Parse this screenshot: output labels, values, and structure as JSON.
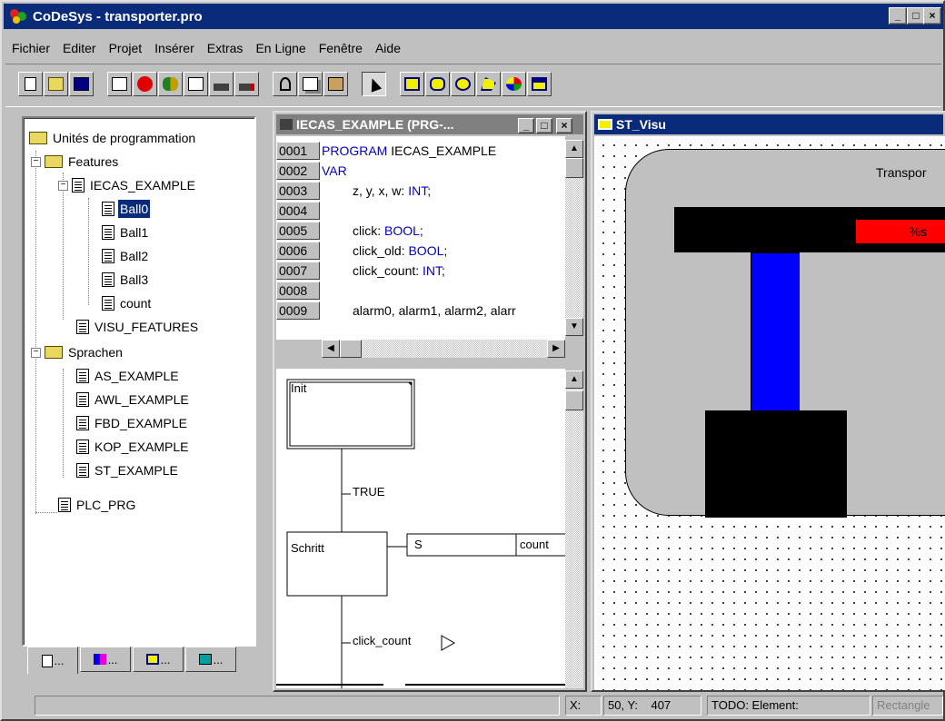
{
  "window": {
    "title": "CoDeSys - transporter.pro",
    "minimize_glyph": "_",
    "restore_glyph": "□",
    "close_glyph": "×",
    "title_color": "#0a2a7a"
  },
  "menu": {
    "items": [
      "Fichier",
      "Editer",
      "Projet",
      "Insérer",
      "Extras",
      "En Ligne",
      "Fenêtre",
      "Aide"
    ]
  },
  "toolbar": {
    "icons": [
      "new-icon",
      "open-icon",
      "save-icon",
      "compile-icon",
      "stop-icon",
      "run-icon",
      "step-over-icon",
      "breakpoint-icon",
      "login-icon",
      "cut-icon",
      "copy-icon",
      "paste-icon",
      "pointer-icon",
      "rectangle-icon",
      "rounded-rectangle-icon",
      "ellipse-icon",
      "polygon-icon",
      "bitmap-icon",
      "visualization-icon"
    ]
  },
  "tree": {
    "root": "Unités de programmation",
    "nodes": {
      "features": "Features",
      "iecas": "IECAS_EXAMPLE",
      "ball0": "Ball0",
      "ball1": "Ball1",
      "ball2": "Ball2",
      "ball3": "Ball3",
      "count": "count",
      "visu_features": "VISU_FEATURES",
      "sprachen": "Sprachen",
      "as_example": "AS_EXAMPLE",
      "awl_example": "AWL_EXAMPLE",
      "fbd_example": "FBD_EXAMPLE",
      "kop_example": "KOP_EXAMPLE",
      "st_example": "ST_EXAMPLE",
      "plc_prg": "PLC_PRG"
    },
    "tabs": [
      "...",
      "...",
      "...",
      "..."
    ]
  },
  "editor": {
    "title": "IECAS_EXAMPLE (PRG-...",
    "title_color": "#808080",
    "lines": [
      {
        "num": "0001",
        "kw": "PROGRAM",
        "rest": " IECAS_EXAMPLE",
        "pre": ""
      },
      {
        "num": "0002",
        "kw": "VAR",
        "rest": "",
        "pre": ""
      },
      {
        "num": "0003",
        "pre": "z, y, x, w: ",
        "kw": "INT",
        "rest": ";"
      },
      {
        "num": "0004",
        "pre": "",
        "kw": "",
        "rest": ""
      },
      {
        "num": "0005",
        "pre": "click: ",
        "kw": "BOOL",
        "rest": ";"
      },
      {
        "num": "0006",
        "pre": "click_old: ",
        "kw": "BOOL",
        "rest": ";"
      },
      {
        "num": "0007",
        "pre": "click_count: ",
        "kw": "INT",
        "rest": ";"
      },
      {
        "num": "0008",
        "pre": "",
        "kw": "",
        "rest": ""
      },
      {
        "num": "0009",
        "pre": "alarm0, alarm1, alarm2, alarr",
        "kw": "",
        "rest": ""
      }
    ],
    "sfc": {
      "init_step": "Init",
      "transition1": "TRUE",
      "step2": "Schritt",
      "action_qualifier": "S",
      "action_name": "count",
      "transition2": "click_count"
    }
  },
  "visu": {
    "title": "ST_Visu",
    "title_color": "#0a2a7a",
    "label": "Transpor",
    "alarm_text": "%s",
    "alarm_color": "#ff0000",
    "bar_color": "#0000ff"
  },
  "status": {
    "x_label": "X:",
    "coords": "50, Y:    407",
    "todo": "TODO: Element:",
    "element": "Rectangle"
  }
}
